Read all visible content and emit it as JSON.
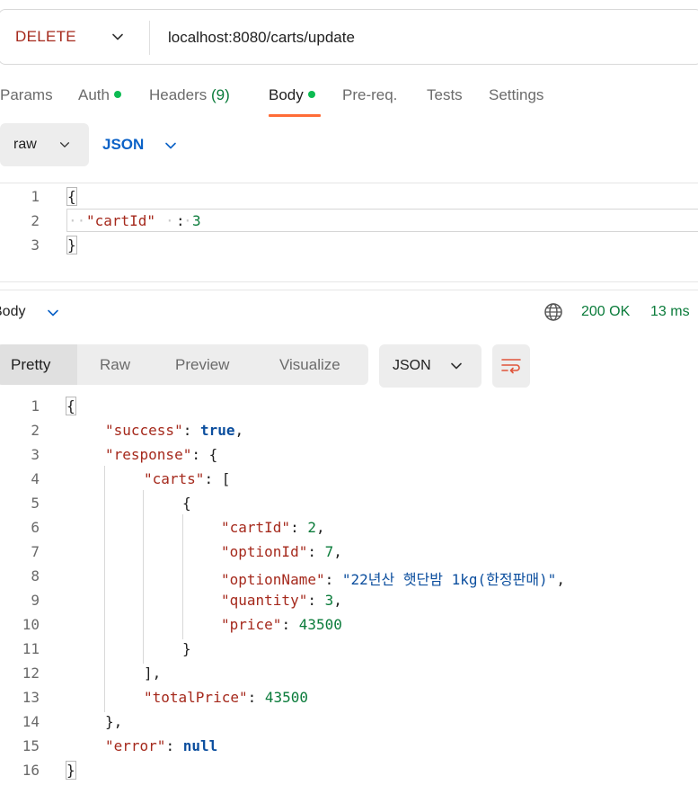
{
  "request": {
    "method": "DELETE",
    "url": "localhost:8080/carts/update"
  },
  "request_tabs": [
    {
      "label": "Params"
    },
    {
      "label": "Auth"
    },
    {
      "label": "Headers",
      "count": "(9)"
    },
    {
      "label": "Body"
    },
    {
      "label": "Pre-req."
    },
    {
      "label": "Tests"
    },
    {
      "label": "Settings"
    }
  ],
  "body_mode": {
    "type": "raw",
    "format": "JSON"
  },
  "request_body": {
    "line_numbers": [
      "1",
      "2",
      "3"
    ],
    "open_brace": "{",
    "key": "\"cartId\"",
    "colon": " : ",
    "value": "3",
    "close_brace": "}"
  },
  "response": {
    "section_label": "Body",
    "status": "200 OK",
    "time": "13 ms",
    "view_tabs": [
      "Pretty",
      "Raw",
      "Preview",
      "Visualize"
    ],
    "format": "JSON",
    "line_numbers": [
      "1",
      "2",
      "3",
      "4",
      "5",
      "6",
      "7",
      "8",
      "9",
      "10",
      "11",
      "12",
      "13",
      "14",
      "15",
      "16"
    ],
    "json": {
      "success_key": "\"success\"",
      "success_val": "true",
      "response_key": "\"response\"",
      "carts_key": "\"carts\"",
      "cartId_key": "\"cartId\"",
      "cartId_val": "2",
      "optionId_key": "\"optionId\"",
      "optionId_val": "7",
      "optionName_key": "\"optionName\"",
      "optionName_val": "\"22년산 햇단밤 1kg(한정판매)\"",
      "quantity_key": "\"quantity\"",
      "quantity_val": "3",
      "price_key": "\"price\"",
      "price_val": "43500",
      "totalPrice_key": "\"totalPrice\"",
      "totalPrice_val": "43500",
      "error_key": "\"error\"",
      "error_val": "null"
    }
  },
  "colors": {
    "method": "#a5291c",
    "accent_underline": "#ff6c37",
    "status_green": "#0a7b3a",
    "json_key": "#a5291c",
    "json_string": "#0b4e9e",
    "json_number": "#0a7b3a"
  },
  "icons": [
    "chevron-down-icon",
    "globe-icon",
    "wrap-lines-icon"
  ]
}
